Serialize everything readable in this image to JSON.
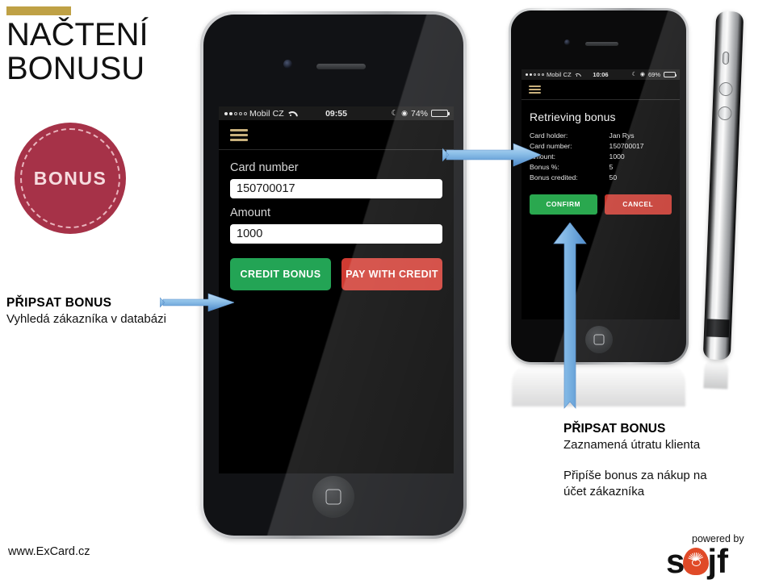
{
  "slide": {
    "title_line1": "NAČTENÍ",
    "title_line2": "BONUSU",
    "badge_label": "BONUS",
    "badge_color": "#a63248",
    "accent_bar_color": "#bfa145"
  },
  "caption_left": {
    "title": "PŘIPSAT BONUS",
    "subtitle": "Vyhledá zákazníka v databázi"
  },
  "caption_right": {
    "title": "PŘIPSAT BONUS",
    "subtitle": "Zaznamená útratu klienta",
    "subtitle2_line1": "Připíše bonus  za nákup na",
    "subtitle2_line2": "účet zákazníka"
  },
  "phone_left": {
    "status_bar": {
      "carrier": "Mobil CZ",
      "time": "09:55",
      "battery_percent": "74%",
      "battery_level": 74,
      "moon_icon": "☾",
      "lock_icon": "◉"
    },
    "menu_icon": "hamburger-icon",
    "form": {
      "card_number_label": "Card number",
      "card_number_value": "150700017",
      "amount_label": "Amount",
      "amount_value": "1000"
    },
    "buttons": {
      "primary": "CREDIT BONUS",
      "primary_color": "#23a455",
      "secondary": "PAY WITH CREDIT",
      "secondary_color": "#cf3b32"
    }
  },
  "phone_right": {
    "status_bar": {
      "carrier": "Mobil CZ",
      "time": "10:06",
      "battery_percent": "69%",
      "battery_level": 69,
      "moon_icon": "☾",
      "lock_icon": "◉"
    },
    "menu_icon": "hamburger-icon",
    "heading": "Retrieving bonus",
    "details": [
      {
        "key": "Card holder:",
        "value": "Jan Rys"
      },
      {
        "key": "Card number:",
        "value": "150700017"
      },
      {
        "key": "Amount:",
        "value": "1000"
      },
      {
        "key": "Bonus %:",
        "value": "5"
      },
      {
        "key": "Bonus credited:",
        "value": "50"
      }
    ],
    "buttons": {
      "confirm": "CONFIRM",
      "confirm_color": "#2aa84f",
      "cancel": "CANCEL",
      "cancel_color": "#c4352c"
    }
  },
  "footer": {
    "url": "www.ExCard.cz",
    "powered_by": "powered by",
    "logo_part1": "s",
    "logo_part2": "jf",
    "logo_accent": "#e04a28"
  }
}
